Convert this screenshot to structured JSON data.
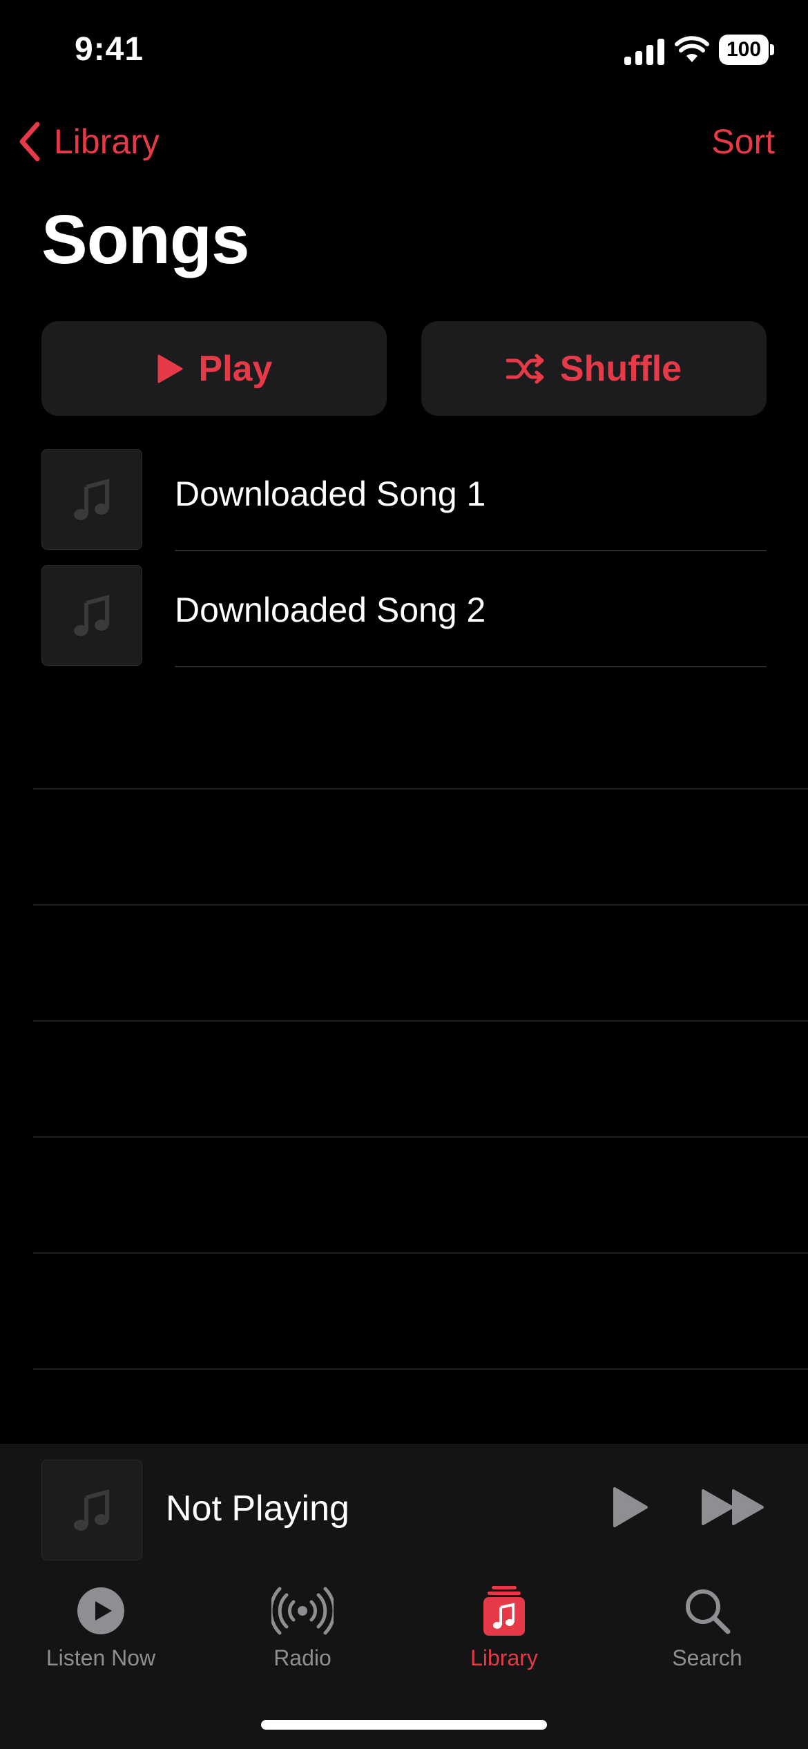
{
  "status_bar": {
    "time": "9:41",
    "battery": "100"
  },
  "nav": {
    "back_label": "Library",
    "sort_label": "Sort"
  },
  "page": {
    "title": "Songs"
  },
  "actions": {
    "play_label": "Play",
    "shuffle_label": "Shuffle"
  },
  "songs": [
    {
      "title": "Downloaded Song 1"
    },
    {
      "title": "Downloaded Song 2"
    }
  ],
  "mini_player": {
    "title": "Not Playing"
  },
  "tabs": [
    {
      "label": "Listen Now",
      "icon": "listen-now-icon"
    },
    {
      "label": "Radio",
      "icon": "radio-icon"
    },
    {
      "label": "Library",
      "icon": "library-icon",
      "active": true
    },
    {
      "label": "Search",
      "icon": "search-icon"
    }
  ],
  "colors": {
    "accent": "#e63a48",
    "background": "#000000",
    "surface": "#1c1c1e",
    "inactive": "#8e8e93"
  }
}
